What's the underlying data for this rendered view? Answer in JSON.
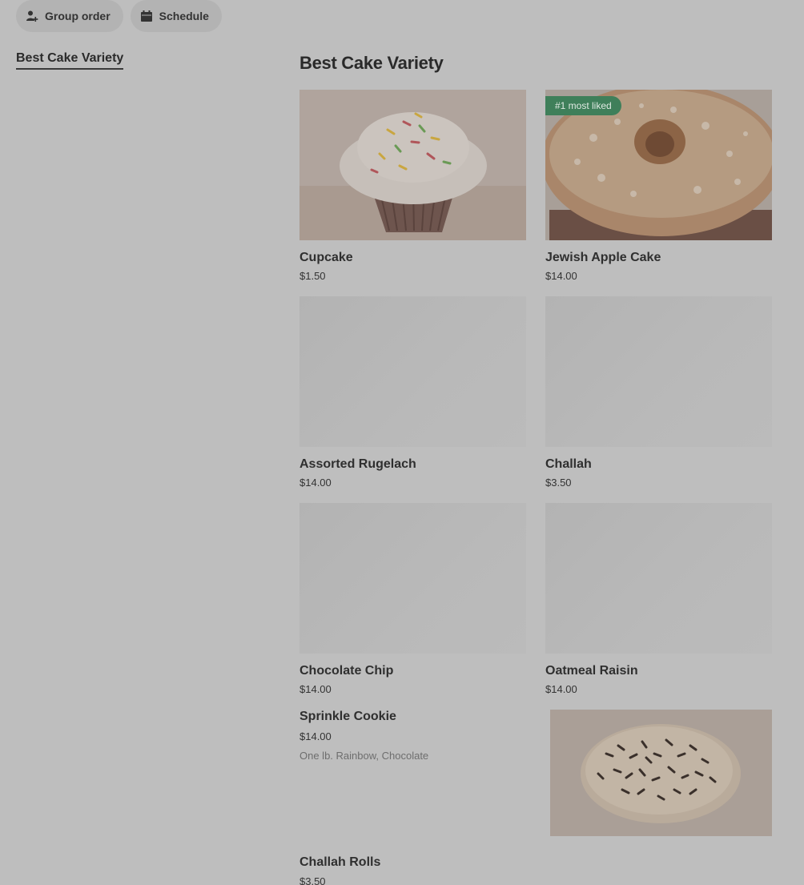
{
  "header": {
    "group_order_label": "Group order",
    "schedule_label": "Schedule"
  },
  "sidebar": {
    "items": [
      {
        "label": "Best Cake Variety"
      }
    ]
  },
  "section": {
    "title": "Best Cake Variety",
    "items": [
      {
        "name": "Cupcake",
        "price": "$1.50",
        "image": "cupcake-photo"
      },
      {
        "name": "Jewish Apple Cake",
        "price": "$14.00",
        "badge": "#1 most liked",
        "image": "apple-cake-photo"
      },
      {
        "name": "Assorted Rugelach",
        "price": "$14.00"
      },
      {
        "name": "Challah",
        "price": "$3.50"
      },
      {
        "name": "Chocolate Chip",
        "price": "$14.00"
      },
      {
        "name": "Oatmeal Raisin",
        "price": "$14.00"
      },
      {
        "name": "Sprinkle Cookie",
        "price": "$14.00",
        "description": "One lb. Rainbow, Chocolate",
        "image": "sprinkle-cookie-photo"
      },
      {
        "name": "Challah Rolls",
        "price": "$3.50"
      }
    ]
  },
  "colors": {
    "badge_bg": "#3f7f5a",
    "page_bg": "#bebebe"
  }
}
